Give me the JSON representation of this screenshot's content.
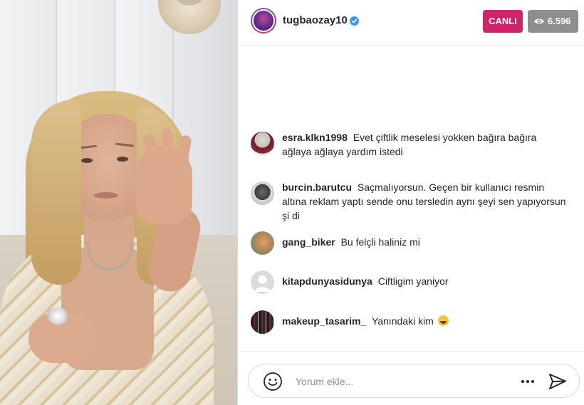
{
  "header": {
    "username": "tugbaozay10",
    "verified_icon": "verified-badge-icon",
    "live_label": "CANLI",
    "viewer_count": "6.596",
    "viewer_icon": "eye-icon"
  },
  "comments": [
    {
      "user": "esra.klkn1998",
      "text": "Evet çiftlik meselesi yokken bağıra bağıra ağlaya ağlaya yardım istedi"
    },
    {
      "user": "burcin.barutcu",
      "text": "Saçmalıyorsun. Geçen bir kullanıcı resmin altına reklam yaptı sende onu tersledin aynı şeyi sen yapıyorsun şi di"
    },
    {
      "user": "gang_biker",
      "text": "Bu felçli haliniz mi"
    },
    {
      "user": "kitapdunyasidunya",
      "text": "Ciftligim yaniyor"
    },
    {
      "user": "makeup_tasarim_",
      "text": "Yanındaki kim"
    }
  ],
  "footer": {
    "placeholder": "Yorum ekle...",
    "emoji_icon": "smile-icon",
    "more_icon": "more-icon",
    "send_icon": "send-icon"
  },
  "colors": {
    "live_badge": "#d1236b",
    "viewer_badge": "#8e8e8e",
    "verified": "#3897f0",
    "text": "#262626",
    "placeholder": "#8e8e8e"
  }
}
